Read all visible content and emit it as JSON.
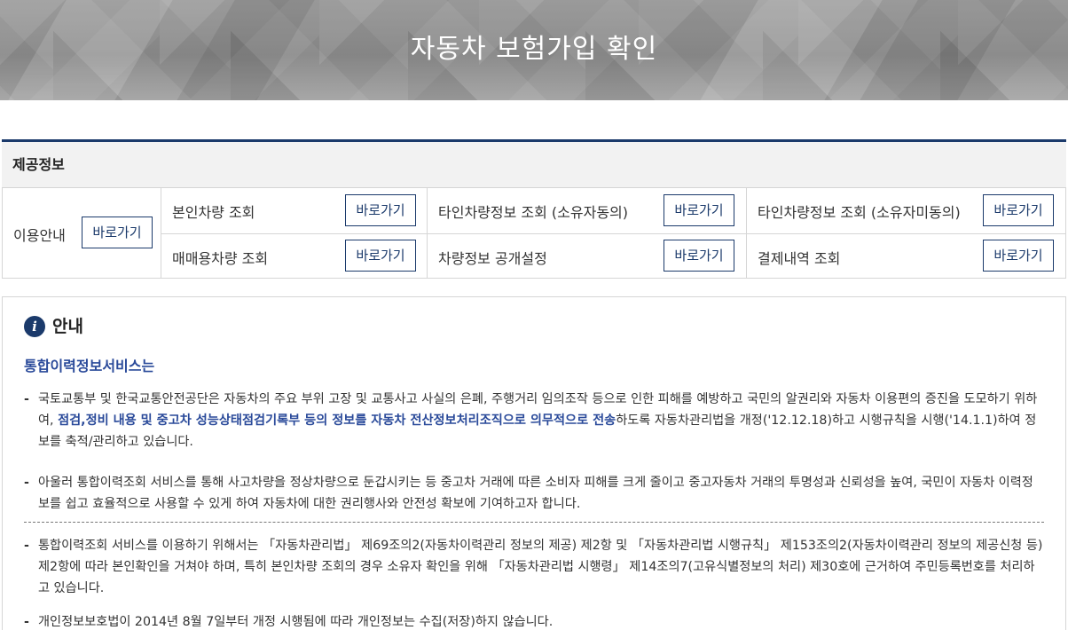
{
  "banner": {
    "title": "자동차 보험가입 확인"
  },
  "provide": {
    "heading": "제공정보",
    "usage": {
      "label": "이용안내",
      "button": "바로가기"
    },
    "items": [
      {
        "label": "본인차량 조회",
        "button": "바로가기"
      },
      {
        "label": "타인차량정보 조회 (소유자동의)",
        "button": "바로가기"
      },
      {
        "label": "타인차량정보 조회 (소유자미동의)",
        "button": "바로가기"
      },
      {
        "label": "매매용차량 조회",
        "button": "바로가기"
      },
      {
        "label": "차량정보 공개설정",
        "button": "바로가기"
      },
      {
        "label": "결제내역 조회",
        "button": "바로가기"
      }
    ]
  },
  "notice": {
    "icon": "info-icon",
    "title": "안내",
    "service_title": "통합이력정보서비스는",
    "item1": {
      "pre": "국토교통부 및 한국교통안전공단은 자동차의 주요 부위 고장 및 교통사고 사실의 은폐, 주행거리 임의조작 등으로 인한 피해를 예방하고 국민의 알권리와 자동차 이용편의 증진을 도모하기 위하여, ",
      "bold": "점검,정비 내용 및 중고차 성능상태점검기록부 등의 정보를 자동차 전산정보처리조직으로 의무적으로 전송",
      "post": "하도록 자동차관리법을 개정('12.12.18)하고 시행규칙을 시행('14.1.1)하여 정보를 축적/관리하고 있습니다."
    },
    "item2": "아울러 통합이력조회 서비스를 통해 사고차량을 정상차량으로 둔갑시키는 등 중고차 거래에 따른 소비자 피해를 크게 줄이고 중고자동차 거래의 투명성과 신뢰성을 높여, 국민이 자동차 이력정보를 쉽고 효율적으로 사용할 수 있게 하여 자동차에 대한 권리행사와 안전성 확보에 기여하고자 합니다.",
    "item3": "통합이력조회 서비스를 이용하기 위해서는 「자동차관리법」 제69조의2(자동차이력관리 정보의 제공) 제2항 및 「자동차관리법 시행규칙」 제153조의2(자동차이력관리 정보의 제공신청 등)제2항에 따라 본인확인을 거쳐야 하며, 특히 본인차량 조회의 경우 소유자 확인을 위해 「자동차관리법 시행령」 제14조의7(고유식별정보의 처리) 제30호에 근거하여 주민등록번호를 처리하고 있습니다.",
    "item4": "개인정보보호법이 2014년 8월 7일부터 개정 시행됨에 따라 개인정보는 수집(저장)하지 않습니다.",
    "dash": "-"
  }
}
